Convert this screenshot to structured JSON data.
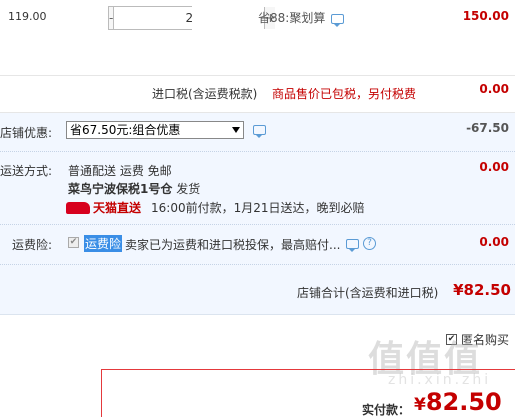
{
  "item": {
    "unit_price": "119.00",
    "qty_minus": "-",
    "qty_value": "2",
    "qty_plus": "+",
    "saving": "省88:聚划算",
    "line_total": "150.00"
  },
  "tax": {
    "label": "进口税(含运费税款)",
    "note": "商品售价已包税，另付税费",
    "value": "0.00"
  },
  "discount": {
    "label": "店铺优惠:",
    "selected": "省67.50元:组合优惠",
    "value": "-67.50"
  },
  "shipping": {
    "label": "运送方式:",
    "line1": "普通配送  运费 免邮",
    "warehouse": "菜鸟宁波保税1号仓",
    "ship_word": "发货",
    "tmall_label": "天猫直送",
    "delivery": "16:00前付款，1月21日送达，晚到必赔",
    "value": "0.00"
  },
  "insurance": {
    "label": "运费险:",
    "tag": "运费险",
    "text": "卖家已为运费和进口税投保，最高赔付...",
    "value": "0.00"
  },
  "store_total": {
    "label": "店铺合计(含运费和进口税)",
    "value": "¥82.50"
  },
  "anonymous": {
    "label": "匿名购买"
  },
  "payment": {
    "label": "实付款：",
    "currency": "¥",
    "amount": "82.50"
  },
  "watermark": {
    "text": "值值值",
    "sub": "zhi.xin.zhi"
  },
  "colors": {
    "price_red": "#c40000",
    "section_bg": "#f2f7ff",
    "insurance_tag": "#3a8ee6",
    "tmall_red": "#d7001e"
  }
}
